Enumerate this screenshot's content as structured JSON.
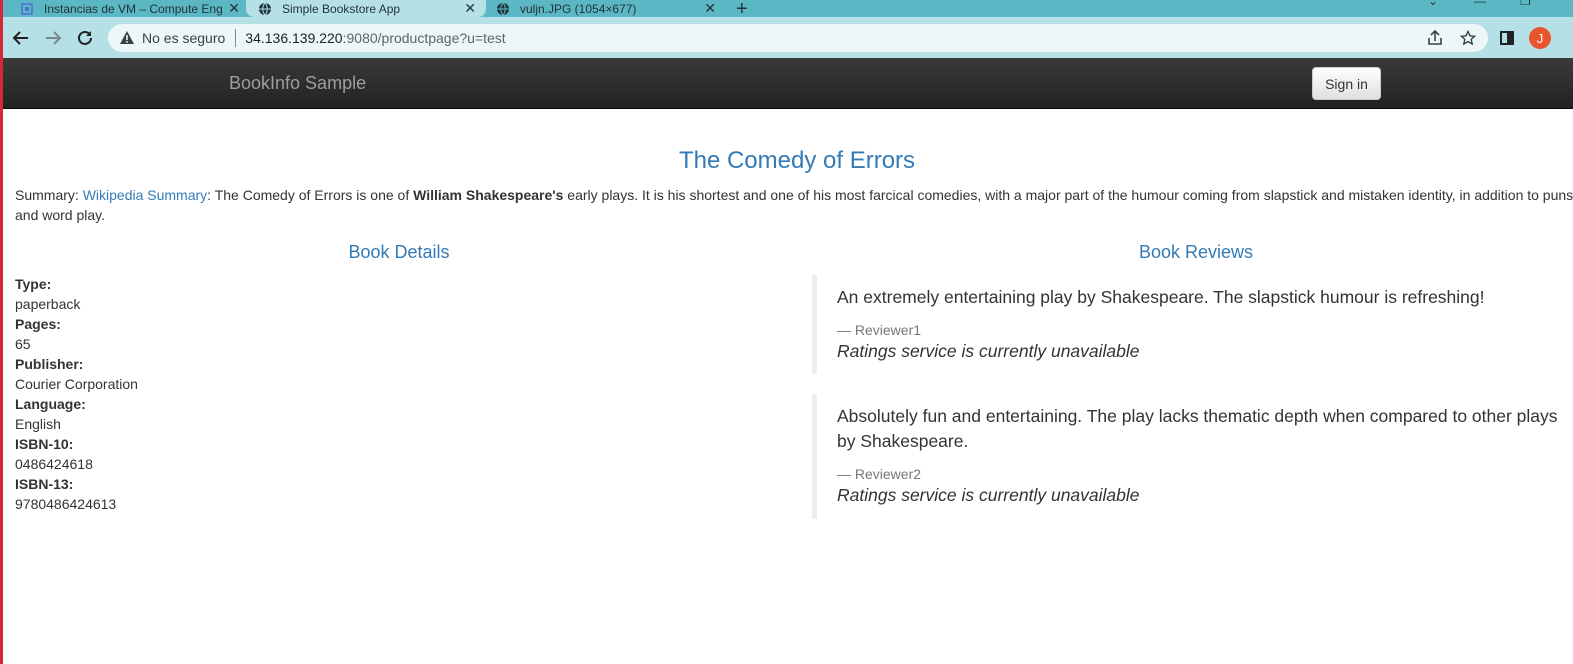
{
  "browser": {
    "tabs": [
      {
        "title": "Instancias de VM – Compute Eng",
        "icon": "compute-engine-icon"
      },
      {
        "title": "Simple Bookstore App",
        "icon": "globe-icon",
        "active": true
      },
      {
        "title": "vuljn.JPG (1054×677)",
        "icon": "globe-icon"
      }
    ],
    "security_label": "No es seguro",
    "url_host": "34.136.139.220",
    "url_rest": ":9080/productpage?u=test",
    "profile_initial": "J",
    "accent": "#5cb7c4",
    "profile_color": "#e8542b"
  },
  "navbar": {
    "brand": "BookInfo Sample",
    "signin_label": "Sign in"
  },
  "book": {
    "title": "The Comedy of Errors",
    "summary_label": "Summary:",
    "summary_link": "Wikipedia Summary",
    "summary_part1": ": The Comedy of Errors is one of ",
    "summary_bold": "William Shakespeare's",
    "summary_part2": " early plays. It is his shortest and one of his most farcical comedies, with a major part of the humour coming from slapstick and mistaken identity, in addition to puns and word play."
  },
  "details": {
    "heading": "Book Details",
    "fields": [
      {
        "label": "Type:",
        "value": "paperback"
      },
      {
        "label": "Pages:",
        "value": "65"
      },
      {
        "label": "Publisher:",
        "value": "Courier Corporation"
      },
      {
        "label": "Language:",
        "value": "English"
      },
      {
        "label": "ISBN-10:",
        "value": "0486424618"
      },
      {
        "label": "ISBN-13:",
        "value": "9780486424613"
      }
    ]
  },
  "reviews": {
    "heading": "Book Reviews",
    "items": [
      {
        "text": "An extremely entertaining play by Shakespeare. The slapstick humour is refreshing!",
        "reviewer": "— Reviewer1",
        "rating": "Ratings service is currently unavailable"
      },
      {
        "text": "Absolutely fun and entertaining. The play lacks thematic depth when compared to other plays by Shakespeare.",
        "reviewer": "— Reviewer2",
        "rating": "Ratings service is currently unavailable"
      }
    ]
  }
}
